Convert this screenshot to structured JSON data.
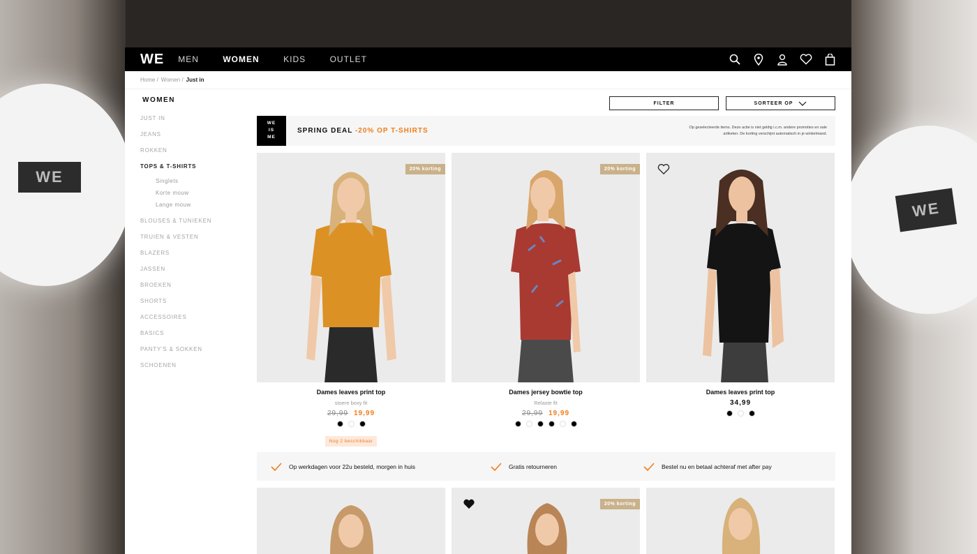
{
  "nav": {
    "logo": "WE",
    "items": [
      {
        "label": "MEN",
        "active": false
      },
      {
        "label": "WOMEN",
        "active": true
      },
      {
        "label": "KIDS",
        "active": false
      },
      {
        "label": "OUTLET",
        "active": false
      }
    ],
    "icons": [
      "search-icon",
      "location-icon",
      "account-icon",
      "heart-icon",
      "bag-icon"
    ]
  },
  "breadcrumb": {
    "home": "Home /",
    "section": "Women /",
    "current": "Just in"
  },
  "sidebar": {
    "title": "WOMEN",
    "items": [
      {
        "label": "JUST IN",
        "dark": false
      },
      {
        "label": "JEANS",
        "dark": false
      },
      {
        "label": "ROKKEN",
        "dark": false
      },
      {
        "label": "TOPS & T-SHIRTS",
        "dark": true
      },
      {
        "label": "Singlets",
        "sub": true
      },
      {
        "label": "Korte mouw",
        "sub": true
      },
      {
        "label": "Lange mouw",
        "sub": true
      },
      {
        "label": "BLOUSES & TUNIEKEN"
      },
      {
        "label": "TRUIEN & VESTEN"
      },
      {
        "label": "BLAZERS"
      },
      {
        "label": "JASSEN"
      },
      {
        "label": "BROEKEN"
      },
      {
        "label": "SHORTS"
      },
      {
        "label": "ACCESSOIRES"
      },
      {
        "label": "BASICS"
      },
      {
        "label": "PANTY'S & SOKKEN"
      },
      {
        "label": "SCHOENEN"
      }
    ]
  },
  "toolbar": {
    "filter": "FILTER",
    "sort": "SORTEER OP"
  },
  "banner": {
    "wm1": "WE",
    "wm2": "IS",
    "wm3": "ME",
    "deal": "SPRING DEAL",
    "deal_accent": "-20% OP T-SHIRTS",
    "fine1": "Op geselecteerde items. Deze actie is niet geldig i.c.m. andere promoties en sale",
    "fine2": "artikelen. De korting verschijnt automatisch in je winkelmand."
  },
  "products": [
    {
      "name": "Dames leaves print top",
      "fit": "stoere boxy fit",
      "old_price": "29,99",
      "price": "19,99",
      "tag": "20% korting",
      "dots": [
        "black",
        "white",
        "black"
      ],
      "stock": "Nog 2 beschikbaar",
      "shirt": "#dc9125"
    },
    {
      "name": "Dames jersey bowtie top",
      "fit": "Relaxte fit",
      "old_price": "29,99",
      "price": "19,99",
      "tag": "20% korting",
      "dots": [
        "black",
        "white",
        "black",
        "black",
        "white",
        "black"
      ],
      "shirt": "#a83a32"
    },
    {
      "name": "Dames leaves print top",
      "price": "34,99",
      "dots": [
        "black",
        "white",
        "black"
      ],
      "shirt": "#141414"
    }
  ],
  "usp": [
    "Op werkdagen voor 22u besteld, morgen in huis",
    "Gratis retourneren",
    "Bestel nu en betaal achteraf met after pay"
  ],
  "second_row": {
    "tag": "20% korting"
  },
  "colors": {
    "accent": "#f07d1a",
    "tag": "#c9b18a",
    "topbar": "#000000"
  }
}
